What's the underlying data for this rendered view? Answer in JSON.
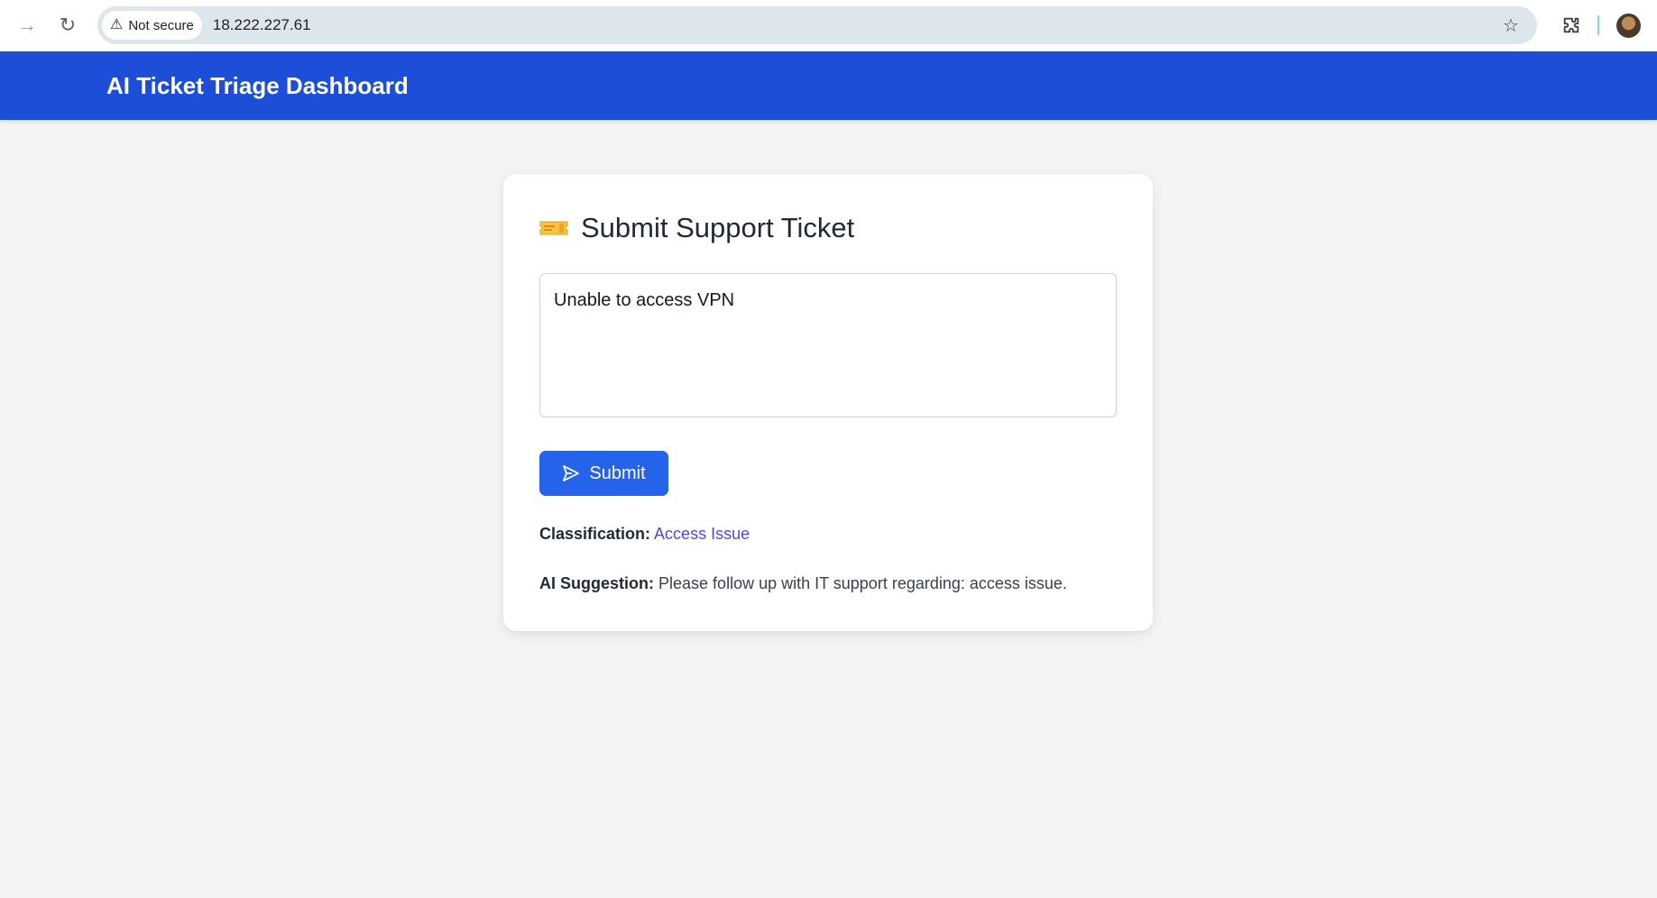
{
  "browser": {
    "security_label": "Not secure",
    "url": "18.222.227.61"
  },
  "header": {
    "title": "AI Ticket Triage Dashboard",
    "color": "#1d4ed8"
  },
  "form": {
    "title": "Submit Support Ticket",
    "title_icon": "ticket-icon",
    "ticket_text": "Unable to access VPN",
    "submit_label": "Submit",
    "submit_color": "#2563eb"
  },
  "result": {
    "classification_label": "Classification:",
    "classification_value": "Access Issue",
    "suggestion_label": "AI Suggestion:",
    "suggestion_value": "Please follow up with IT support regarding: access issue."
  }
}
